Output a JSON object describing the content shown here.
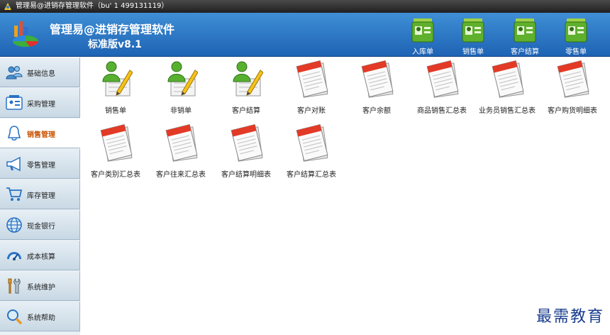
{
  "window": {
    "title": "管理易@进销存管理软件（bu' 1 499131119）"
  },
  "header": {
    "app_name": "管理易@进销存管理软件",
    "version": "标准版v8.1",
    "toolbar": [
      {
        "label": "入库单",
        "icon": "id-card-icon"
      },
      {
        "label": "销售单",
        "icon": "id-card-icon"
      },
      {
        "label": "客户结算",
        "icon": "id-card-icon"
      },
      {
        "label": "零售单",
        "icon": "id-card-icon"
      }
    ]
  },
  "sidebar": {
    "items": [
      {
        "label": "基础信息",
        "icon": "users-icon"
      },
      {
        "label": "采购管理",
        "icon": "id-card-icon"
      },
      {
        "label": "销售管理",
        "icon": "bell-icon",
        "active": true
      },
      {
        "label": "零售管理",
        "icon": "megaphone-icon"
      },
      {
        "label": "库存管理",
        "icon": "cart-icon"
      },
      {
        "label": "现金银行",
        "icon": "globe-icon"
      },
      {
        "label": "成本核算",
        "icon": "gauge-icon"
      },
      {
        "label": "系统维护",
        "icon": "tools-icon"
      },
      {
        "label": "系统帮助",
        "icon": "magnifier-icon"
      }
    ]
  },
  "content": {
    "tiles": [
      {
        "label": "销售单",
        "icon": "person-pencil-icon"
      },
      {
        "label": "非销单",
        "icon": "person-pencil-icon"
      },
      {
        "label": "客户结算",
        "icon": "person-pencil-icon"
      },
      {
        "label": "客户对账",
        "icon": "report-icon"
      },
      {
        "label": "客户余额",
        "icon": "report-icon"
      },
      {
        "label": "商品销售汇总表",
        "icon": "report-icon"
      },
      {
        "label": "业务员销售汇总表",
        "icon": "report-icon"
      },
      {
        "label": "客户购货明细表",
        "icon": "report-icon"
      },
      {
        "label": "客户类别汇总表",
        "icon": "report-icon"
      },
      {
        "label": "客户往来汇总表",
        "icon": "report-icon"
      },
      {
        "label": "客户结算明细表",
        "icon": "report-icon"
      },
      {
        "label": "客户结算汇总表",
        "icon": "report-icon"
      }
    ]
  },
  "watermark": "最需教育",
  "colors": {
    "header_blue": "#2a73c4",
    "active_nav_text": "#c95200",
    "watermark": "#1a3d8f"
  }
}
